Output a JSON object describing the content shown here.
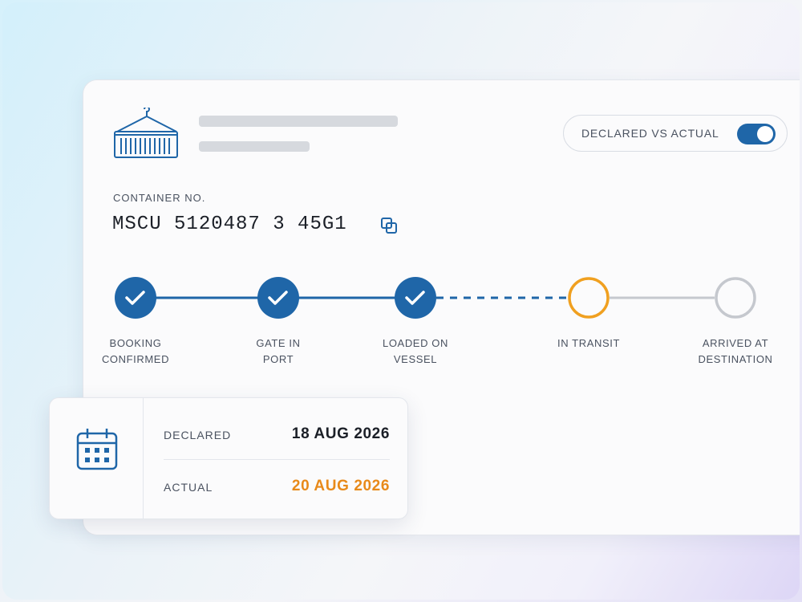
{
  "toggle": {
    "label": "DECLARED VS ACTUAL",
    "state": "on",
    "color": "#1f66a8"
  },
  "container": {
    "label": "CONTAINER NO.",
    "number": "MSCU 5120487 3 45G1"
  },
  "steps": [
    {
      "label_line1": "BOOKING",
      "label_line2": "CONFIRMED",
      "status": "done"
    },
    {
      "label_line1": "GATE IN",
      "label_line2": "PORT",
      "status": "done"
    },
    {
      "label_line1": "LOADED ON",
      "label_line2": "VESSEL",
      "status": "done"
    },
    {
      "label_line1": "IN TRANSIT",
      "label_line2": "",
      "status": "current"
    },
    {
      "label_line1": "ARRIVED AT",
      "label_line2": "DESTINATION",
      "status": "pending"
    }
  ],
  "dates": {
    "declared_label": "DECLARED",
    "declared_value": "18 AUG 2026",
    "actual_label": "ACTUAL",
    "actual_value": "20 AUG 2026"
  },
  "colors": {
    "primary": "#1f66a8",
    "current": "#f0a020",
    "pending": "#c5c8ce",
    "actual": "#e88a1a"
  },
  "icons": [
    "container-icon",
    "copy-icon",
    "check-icon",
    "calendar-icon"
  ]
}
